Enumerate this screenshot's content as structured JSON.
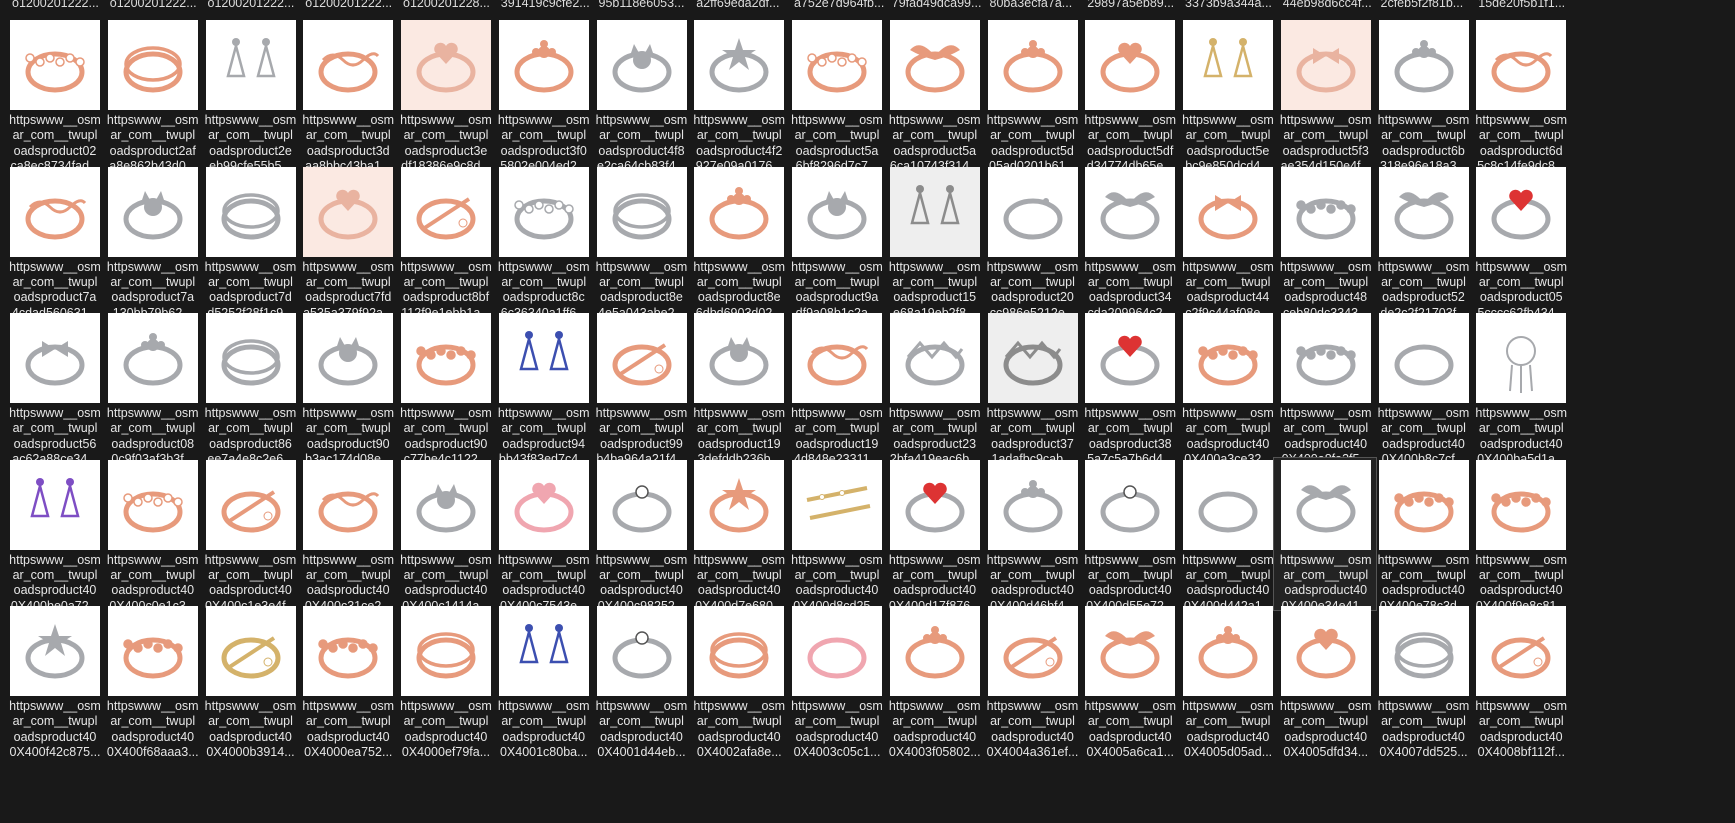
{
  "top_labels": [
    "o1200201222...",
    "o1200201222...",
    "o1200201222...",
    "o1200201222...",
    "o1200201228...",
    "391419c9cfe2...",
    "95b118e6053...",
    "a2ff69eda2df...",
    "a752e7d964fb...",
    "79fad49dca99...",
    "80ba3ecfa7a...",
    "29897a5eb89...",
    "3373b9a344a...",
    "44eb98d6cc4f...",
    "2cfeb5f2f81b...",
    "15de20f5b1f1..."
  ],
  "rows": [
    [
      {
        "l1": "httpswww__osm",
        "l2": "ar_com__twupl",
        "l3": "oadsproduct02",
        "l4": "ca8ec8734fad...",
        "tone": "rose",
        "shape": "ring-gems"
      },
      {
        "l1": "httpswww__osm",
        "l2": "ar_com__twupl",
        "l3": "oadsproduct2af",
        "l4": "a8e862b43d0...",
        "tone": "rose",
        "shape": "ring-double"
      },
      {
        "l1": "httpswww__osm",
        "l2": "ar_com__twupl",
        "l3": "oadsproduct2e",
        "l4": "eb99cfe55b5...",
        "tone": "silver",
        "shape": "earrings"
      },
      {
        "l1": "httpswww__osm",
        "l2": "ar_com__twupl",
        "l3": "oadsproduct3d",
        "l4": "aa8bbc43ba1...",
        "tone": "rose",
        "shape": "ring-wave"
      },
      {
        "l1": "httpswww__osm",
        "l2": "ar_com__twupl",
        "l3": "oadsproduct3e",
        "l4": "df18386e9c8d...",
        "tone": "warm",
        "shape": "ring-heart"
      },
      {
        "l1": "httpswww__osm",
        "l2": "ar_com__twupl",
        "l3": "oadsproduct3f0",
        "l4": "5802e004ed2...",
        "tone": "rose",
        "shape": "ring-flower"
      },
      {
        "l1": "httpswww__osm",
        "l2": "ar_com__twupl",
        "l3": "oadsproduct4f8",
        "l4": "e2ca64cb83f4...",
        "tone": "silver",
        "shape": "ring-cat"
      },
      {
        "l1": "httpswww__osm",
        "l2": "ar_com__twupl",
        "l3": "oadsproduct4f2",
        "l4": "927e09a0176...",
        "tone": "silver",
        "shape": "ring-star"
      },
      {
        "l1": "httpswww__osm",
        "l2": "ar_com__twupl",
        "l3": "oadsproduct5a",
        "l4": "6bf8296d7c7...",
        "tone": "rose",
        "shape": "ring-gems"
      },
      {
        "l1": "httpswww__osm",
        "l2": "ar_com__twupl",
        "l3": "oadsproduct5a",
        "l4": "6ca10743f314...",
        "tone": "rose",
        "shape": "ring-wings"
      },
      {
        "l1": "httpswww__osm",
        "l2": "ar_com__twupl",
        "l3": "oadsproduct5d",
        "l4": "05ad0201b61...",
        "tone": "rose",
        "shape": "ring-flower"
      },
      {
        "l1": "httpswww__osm",
        "l2": "ar_com__twupl",
        "l3": "oadsproduct5df",
        "l4": "d34774db65e...",
        "tone": "rose",
        "shape": "ring-heart"
      },
      {
        "l1": "httpswww__osm",
        "l2": "ar_com__twupl",
        "l3": "oadsproduct5e",
        "l4": "bc9e850dcd4...",
        "tone": "gold",
        "shape": "earrings"
      },
      {
        "l1": "httpswww__osm",
        "l2": "ar_com__twupl",
        "l3": "oadsproduct5f3",
        "l4": "ae354d150e4f...",
        "tone": "warm",
        "shape": "ring-bow"
      },
      {
        "l1": "httpswww__osm",
        "l2": "ar_com__twupl",
        "l3": "oadsproduct6b",
        "l4": "318e96e18a3...",
        "tone": "silver",
        "shape": "ring-flower"
      },
      {
        "l1": "httpswww__osm",
        "l2": "ar_com__twupl",
        "l3": "oadsproduct6d",
        "l4": "5c8c14fe9dc8...",
        "tone": "rose",
        "shape": "ring-wave"
      }
    ],
    [
      {
        "l1": "httpswww__osm",
        "l2": "ar_com__twupl",
        "l3": "oadsproduct7a",
        "l4": "4cdad560631...",
        "tone": "rose",
        "shape": "ring-wave"
      },
      {
        "l1": "httpswww__osm",
        "l2": "ar_com__twupl",
        "l3": "oadsproduct7a",
        "l4": "130bb79b62...",
        "tone": "silver",
        "shape": "ring-cat"
      },
      {
        "l1": "httpswww__osm",
        "l2": "ar_com__twupl",
        "l3": "oadsproduct7d",
        "l4": "d5252f28f1c9...",
        "tone": "silver",
        "shape": "ring-double"
      },
      {
        "l1": "httpswww__osm",
        "l2": "ar_com__twupl",
        "l3": "oadsproduct7fd",
        "l4": "a535a379f92a...",
        "tone": "warm",
        "shape": "ring-heart"
      },
      {
        "l1": "httpswww__osm",
        "l2": "ar_com__twupl",
        "l3": "oadsproduct8bf",
        "l4": "112f9e1ebb1a...",
        "tone": "rose",
        "shape": "ring-cross"
      },
      {
        "l1": "httpswww__osm",
        "l2": "ar_com__twupl",
        "l3": "oadsproduct8c",
        "l4": "6c36340a1ff6...",
        "tone": "silver",
        "shape": "ring-gems"
      },
      {
        "l1": "httpswww__osm",
        "l2": "ar_com__twupl",
        "l3": "oadsproduct8e",
        "l4": "4e5a043abe2...",
        "tone": "silver",
        "shape": "ring-double"
      },
      {
        "l1": "httpswww__osm",
        "l2": "ar_com__twupl",
        "l3": "oadsproduct8e",
        "l4": "6dbd6903d02...",
        "tone": "rose",
        "shape": "ring-flower"
      },
      {
        "l1": "httpswww__osm",
        "l2": "ar_com__twupl",
        "l3": "oadsproduct9a",
        "l4": "df9a08b1c2a...",
        "tone": "silver",
        "shape": "ring-cat"
      },
      {
        "l1": "httpswww__osm",
        "l2": "ar_com__twupl",
        "l3": "oadsproduct15",
        "l4": "e68a19eb2f8...",
        "tone": "grey",
        "shape": "earrings"
      },
      {
        "l1": "httpswww__osm",
        "l2": "ar_com__twupl",
        "l3": "oadsproduct20",
        "l4": "cc986e5212e...",
        "tone": "silver",
        "shape": "ring-moon"
      },
      {
        "l1": "httpswww__osm",
        "l2": "ar_com__twupl",
        "l3": "oadsproduct34",
        "l4": "cda209964c2...",
        "tone": "silver",
        "shape": "ring-wings"
      },
      {
        "l1": "httpswww__osm",
        "l2": "ar_com__twupl",
        "l3": "oadsproduct44",
        "l4": "c2f9c44af08e...",
        "tone": "rose",
        "shape": "ring-bow"
      },
      {
        "l1": "httpswww__osm",
        "l2": "ar_com__twupl",
        "l3": "oadsproduct48",
        "l4": "ceb80dc3343...",
        "tone": "silver",
        "shape": "ring-beads"
      },
      {
        "l1": "httpswww__osm",
        "l2": "ar_com__twupl",
        "l3": "oadsproduct52",
        "l4": "de2c2f21703f...",
        "tone": "silver",
        "shape": "ring-wings"
      },
      {
        "l1": "httpswww__osm",
        "l2": "ar_com__twupl",
        "l3": "oadsproduct05",
        "l4": "5cccc62fb434...",
        "tone": "silver",
        "shape": "ring-heart"
      }
    ],
    [
      {
        "l1": "httpswww__osm",
        "l2": "ar_com__twupl",
        "l3": "oadsproduct56",
        "l4": "ac62a88ce34...",
        "tone": "silver",
        "shape": "ring-bow"
      },
      {
        "l1": "httpswww__osm",
        "l2": "ar_com__twupl",
        "l3": "oadsproduct08",
        "l4": "0c9f03af3b3f...",
        "tone": "silver",
        "shape": "ring-flower"
      },
      {
        "l1": "httpswww__osm",
        "l2": "ar_com__twupl",
        "l3": "oadsproduct86",
        "l4": "ee7a4e8c2e6...",
        "tone": "silver",
        "shape": "ring-double"
      },
      {
        "l1": "httpswww__osm",
        "l2": "ar_com__twupl",
        "l3": "oadsproduct90",
        "l4": "b3ac174d08e...",
        "tone": "silver",
        "shape": "ring-cat"
      },
      {
        "l1": "httpswww__osm",
        "l2": "ar_com__twupl",
        "l3": "oadsproduct90",
        "l4": "c77be4c1122...",
        "tone": "rose",
        "shape": "ring-chain"
      },
      {
        "l1": "httpswww__osm",
        "l2": "ar_com__twupl",
        "l3": "oadsproduct94",
        "l4": "bb43f83ed7c4...",
        "tone": "blue",
        "shape": "earrings"
      },
      {
        "l1": "httpswww__osm",
        "l2": "ar_com__twupl",
        "l3": "oadsproduct99",
        "l4": "b4ba964a21f4...",
        "tone": "rose",
        "shape": "ring-cross"
      },
      {
        "l1": "httpswww__osm",
        "l2": "ar_com__twupl",
        "l3": "oadsproduct19",
        "l4": "3defddb236b...",
        "tone": "silver",
        "shape": "ring-cat"
      },
      {
        "l1": "httpswww__osm",
        "l2": "ar_com__twupl",
        "l3": "oadsproduct19",
        "l4": "4d848e23311...",
        "tone": "rose",
        "shape": "ring-wave"
      },
      {
        "l1": "httpswww__osm",
        "l2": "ar_com__twupl",
        "l3": "oadsproduct23",
        "l4": "2bfa419eac6b...",
        "tone": "silver",
        "shape": "ring-zigzag"
      },
      {
        "l1": "httpswww__osm",
        "l2": "ar_com__twupl",
        "l3": "oadsproduct37",
        "l4": "1adafbc9cab...",
        "tone": "grey",
        "shape": "ring-zigzag"
      },
      {
        "l1": "httpswww__osm",
        "l2": "ar_com__twupl",
        "l3": "oadsproduct38",
        "l4": "5a7c5a7b6d4...",
        "tone": "silver",
        "shape": "ring-heart"
      },
      {
        "l1": "httpswww__osm",
        "l2": "ar_com__twupl",
        "l3": "oadsproduct40",
        "l4": "0X400a3ce32...",
        "tone": "rose",
        "shape": "ring-chain"
      },
      {
        "l1": "httpswww__osm",
        "l2": "ar_com__twupl",
        "l3": "oadsproduct40",
        "l4": "0X400a8fa3f5...",
        "tone": "silver",
        "shape": "ring-beads"
      },
      {
        "l1": "httpswww__osm",
        "l2": "ar_com__twupl",
        "l3": "oadsproduct40",
        "l4": "0X400b8c7cf...",
        "tone": "silver",
        "shape": "ring-thin"
      },
      {
        "l1": "httpswww__osm",
        "l2": "ar_com__twupl",
        "l3": "oadsproduct40",
        "l4": "0X400ba5d1a...",
        "tone": "silver",
        "shape": "dreamcatcher"
      }
    ],
    [
      {
        "l1": "httpswww__osm",
        "l2": "ar_com__twupl",
        "l3": "oadsproduct40",
        "l4": "0X400be0a72...",
        "tone": "purple",
        "shape": "earrings"
      },
      {
        "l1": "httpswww__osm",
        "l2": "ar_com__twupl",
        "l3": "oadsproduct40",
        "l4": "0X400c0e1c3...",
        "tone": "rose",
        "shape": "ring-gems"
      },
      {
        "l1": "httpswww__osm",
        "l2": "ar_com__twupl",
        "l3": "oadsproduct40",
        "l4": "0X400c1e3e4f...",
        "tone": "rose",
        "shape": "ring-cross"
      },
      {
        "l1": "httpswww__osm",
        "l2": "ar_com__twupl",
        "l3": "oadsproduct40",
        "l4": "0X400c31ce2...",
        "tone": "rose",
        "shape": "ring-wave"
      },
      {
        "l1": "httpswww__osm",
        "l2": "ar_com__twupl",
        "l3": "oadsproduct40",
        "l4": "0X400c1414a...",
        "tone": "silver",
        "shape": "ring-cat"
      },
      {
        "l1": "httpswww__osm",
        "l2": "ar_com__twupl",
        "l3": "oadsproduct40",
        "l4": "0X400c7543e...",
        "tone": "pink",
        "shape": "ring-heart"
      },
      {
        "l1": "httpswww__osm",
        "l2": "ar_com__twupl",
        "l3": "oadsproduct40",
        "l4": "0X400c98252...",
        "tone": "silver",
        "shape": "ring-solitaire"
      },
      {
        "l1": "httpswww__osm",
        "l2": "ar_com__twupl",
        "l3": "oadsproduct40",
        "l4": "0X400d7e680...",
        "tone": "rose",
        "shape": "ring-star"
      },
      {
        "l1": "httpswww__osm",
        "l2": "ar_com__twupl",
        "l3": "oadsproduct40",
        "l4": "0X400d8cd25...",
        "tone": "gold",
        "shape": "hairpins"
      },
      {
        "l1": "httpswww__osm",
        "l2": "ar_com__twupl",
        "l3": "oadsproduct40",
        "l4": "0X400d17f876...",
        "tone": "silver",
        "shape": "ring-heart"
      },
      {
        "l1": "httpswww__osm",
        "l2": "ar_com__twupl",
        "l3": "oadsproduct40",
        "l4": "0X400d46bf4...",
        "tone": "silver",
        "shape": "ring-flower"
      },
      {
        "l1": "httpswww__osm",
        "l2": "ar_com__twupl",
        "l3": "oadsproduct40",
        "l4": "0X400d55e72...",
        "tone": "silver",
        "shape": "ring-solitaire"
      },
      {
        "l1": "httpswww__osm",
        "l2": "ar_com__twupl",
        "l3": "oadsproduct40",
        "l4": "0X400d442a1...",
        "tone": "silver",
        "shape": "ring-thin"
      },
      {
        "l1": "httpswww__osm",
        "l2": "ar_com__twupl",
        "l3": "oadsproduct40",
        "l4": "0X400e34e41...",
        "tone": "silver",
        "shape": "ring-wings",
        "selected": true
      },
      {
        "l1": "httpswww__osm",
        "l2": "ar_com__twupl",
        "l3": "oadsproduct40",
        "l4": "0X400e78c3d...",
        "tone": "rose",
        "shape": "ring-chain"
      },
      {
        "l1": "httpswww__osm",
        "l2": "ar_com__twupl",
        "l3": "oadsproduct40",
        "l4": "0X400f9e8c81...",
        "tone": "rose",
        "shape": "ring-chain"
      }
    ],
    [
      {
        "l1": "httpswww__osm",
        "l2": "ar_com__twupl",
        "l3": "oadsproduct40",
        "l4": "0X400f42c875...",
        "tone": "silver",
        "shape": "ring-star"
      },
      {
        "l1": "httpswww__osm",
        "l2": "ar_com__twupl",
        "l3": "oadsproduct40",
        "l4": "0X400f68aaa3...",
        "tone": "rose",
        "shape": "ring-chain"
      },
      {
        "l1": "httpswww__osm",
        "l2": "ar_com__twupl",
        "l3": "oadsproduct40",
        "l4": "0X4000b3914...",
        "tone": "gold",
        "shape": "ring-cross"
      },
      {
        "l1": "httpswww__osm",
        "l2": "ar_com__twupl",
        "l3": "oadsproduct40",
        "l4": "0X4000ea752...",
        "tone": "rose",
        "shape": "ring-chain"
      },
      {
        "l1": "httpswww__osm",
        "l2": "ar_com__twupl",
        "l3": "oadsproduct40",
        "l4": "0X4000ef79fa...",
        "tone": "rose",
        "shape": "ring-double"
      },
      {
        "l1": "httpswww__osm",
        "l2": "ar_com__twupl",
        "l3": "oadsproduct40",
        "l4": "0X4001c80ba...",
        "tone": "blue",
        "shape": "earrings"
      },
      {
        "l1": "httpswww__osm",
        "l2": "ar_com__twupl",
        "l3": "oadsproduct40",
        "l4": "0X4001d44eb...",
        "tone": "silver",
        "shape": "ring-solitaire"
      },
      {
        "l1": "httpswww__osm",
        "l2": "ar_com__twupl",
        "l3": "oadsproduct40",
        "l4": "0X4002afa8e...",
        "tone": "rose",
        "shape": "ring-double"
      },
      {
        "l1": "httpswww__osm",
        "l2": "ar_com__twupl",
        "l3": "oadsproduct40",
        "l4": "0X4003c05c1...",
        "tone": "pink",
        "shape": "ring-thin"
      },
      {
        "l1": "httpswww__osm",
        "l2": "ar_com__twupl",
        "l3": "oadsproduct40",
        "l4": "0X4003f05802...",
        "tone": "rose",
        "shape": "ring-flower"
      },
      {
        "l1": "httpswww__osm",
        "l2": "ar_com__twupl",
        "l3": "oadsproduct40",
        "l4": "0X4004a361ef...",
        "tone": "rose",
        "shape": "ring-cross"
      },
      {
        "l1": "httpswww__osm",
        "l2": "ar_com__twupl",
        "l3": "oadsproduct40",
        "l4": "0X4005a6ca1...",
        "tone": "rose",
        "shape": "ring-wings"
      },
      {
        "l1": "httpswww__osm",
        "l2": "ar_com__twupl",
        "l3": "oadsproduct40",
        "l4": "0X4005d05ad...",
        "tone": "rose",
        "shape": "ring-flower"
      },
      {
        "l1": "httpswww__osm",
        "l2": "ar_com__twupl",
        "l3": "oadsproduct40",
        "l4": "0X4005dfd34...",
        "tone": "rose",
        "shape": "ring-heart"
      },
      {
        "l1": "httpswww__osm",
        "l2": "ar_com__twupl",
        "l3": "oadsproduct40",
        "l4": "0X4007dd525...",
        "tone": "silver",
        "shape": "ring-double"
      },
      {
        "l1": "httpswww__osm",
        "l2": "ar_com__twupl",
        "l3": "oadsproduct40",
        "l4": "0X4008bf112f...",
        "tone": "rose",
        "shape": "ring-cross"
      }
    ]
  ],
  "colors": {
    "background": "#191919",
    "text": "#e6e6e6",
    "thumb_bg": "#ffffff",
    "selected_border": "#555555",
    "rose": "#e79a7c",
    "silver": "#a7a9ad",
    "gold": "#d4b26a",
    "grey": "#8c8c8c",
    "blue": "#3c4fb0",
    "purple": "#7e4ec4",
    "pink": "#f0a6b0",
    "warm": "#e9b3a0"
  }
}
